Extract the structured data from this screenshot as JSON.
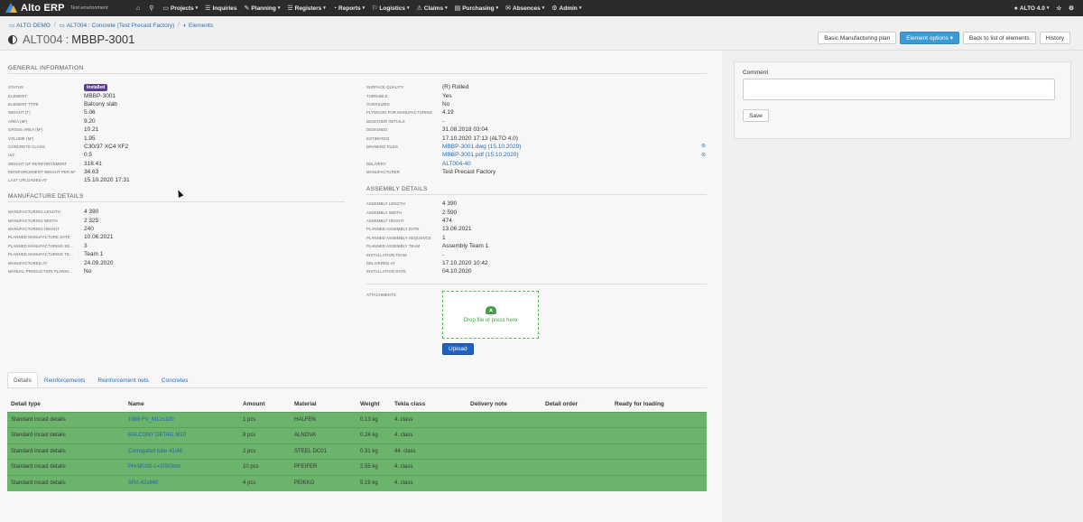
{
  "app": {
    "brand": "Alto ERP",
    "environment": "Test environment",
    "menu": [
      {
        "icon": "⌂",
        "label": "",
        "name": "home",
        "caret": false
      },
      {
        "icon": "⚲",
        "label": "",
        "name": "search",
        "caret": false
      },
      {
        "icon": "▭",
        "label": "Projects",
        "name": "projects",
        "caret": true
      },
      {
        "icon": "☰",
        "label": "Inquiries",
        "name": "inquiries",
        "caret": false
      },
      {
        "icon": "✎",
        "label": "Planning",
        "name": "planning",
        "caret": true
      },
      {
        "icon": "☰",
        "label": "Registers",
        "name": "registers",
        "caret": true
      },
      {
        "icon": "◔",
        "label": "Reports",
        "name": "reports",
        "caret": true
      },
      {
        "icon": "⚐",
        "label": "Logistics",
        "name": "logistics",
        "caret": true
      },
      {
        "icon": "⚠",
        "label": "Claims",
        "name": "claims",
        "caret": true
      },
      {
        "icon": "▤",
        "label": "Purchasing",
        "name": "purchasing",
        "caret": true
      },
      {
        "icon": "✉",
        "label": "Absences",
        "name": "absences",
        "caret": true
      },
      {
        "icon": "⚙",
        "label": "Admin",
        "name": "admin",
        "caret": true
      }
    ],
    "user_label": "ALTO 4.0",
    "star_icon": "☆",
    "settings_icon": "⚙"
  },
  "breadcrumb": [
    {
      "label": "ALTO DEMO",
      "icon": "▭"
    },
    {
      "label": "ALT004 : Concrete (Test Precast Factory)",
      "icon": "▭"
    },
    {
      "label": "Elements",
      "icon": "◐"
    }
  ],
  "title": {
    "prefix": "ALT004",
    "separator": ":",
    "code": "MBBP-3001"
  },
  "actions": {
    "basic_plan": "Basic Manufacturing plan",
    "element_options": "Element options",
    "back": "Back to list of elements",
    "history": "History"
  },
  "general": {
    "title": "GENERAL INFORMATION",
    "left": [
      {
        "label": "Status",
        "value": "Installed",
        "badge": true
      },
      {
        "label": "Element",
        "value": "MBBP-3001"
      },
      {
        "label": "Element type",
        "value": "Balcony slab"
      },
      {
        "label": "Weight (t)",
        "value": "5.06"
      },
      {
        "label": "Area (m²)",
        "value": "9.20"
      },
      {
        "label": "Gross area (m²)",
        "value": "10.21"
      },
      {
        "label": "Volume (m³)",
        "value": "1.95"
      },
      {
        "label": "Concrete class",
        "value": "C30/37 XC4 XF2"
      },
      {
        "label": "U/C",
        "value": "0.5"
      },
      {
        "label": "Weight of reinforcement",
        "value": "318.41"
      },
      {
        "label": "Reinforcement weight per m³",
        "value": "34.63"
      },
      {
        "label": "Last uploaded at",
        "value": "15.10.2020 17:31"
      }
    ],
    "right": [
      {
        "label": "Surface quality",
        "value": "(R) Rolled"
      },
      {
        "label": "Turnable",
        "value": "Yes"
      },
      {
        "label": "Oversized",
        "value": "No"
      },
      {
        "label": "Plywood for manufacturing",
        "value": "4.19"
      },
      {
        "label": "Designer initials",
        "value": "-"
      },
      {
        "label": "Designed",
        "value": "31.08.2018 03:04"
      },
      {
        "label": "Estimated",
        "value": "17.10.2020 17:13 (ALTO 4.0)"
      },
      {
        "label": "Drawing files",
        "value": "MBBP-3001.dwg (15.10.2020)",
        "link": true
      },
      {
        "label": "",
        "value": "MBBP-3001.pdf (15.10.2020)",
        "link": true
      },
      {
        "label": "Delivery",
        "value": "ALT004-40",
        "link": true
      },
      {
        "label": "Manufacturer",
        "value": "Test Precast Factory"
      }
    ]
  },
  "manufacture": {
    "title": "MANUFACTURE DETAILS",
    "rows": [
      {
        "label": "Manufacturing length",
        "value": "4 390"
      },
      {
        "label": "Manufacturing width",
        "value": "2 325"
      },
      {
        "label": "Manufacturing height",
        "value": "240"
      },
      {
        "label": "Planned manufacture date",
        "value": "10.06.2021"
      },
      {
        "label": "Planned manufacturing se...",
        "value": "3"
      },
      {
        "label": "Planned manufacturing te...",
        "value": "Team 1"
      },
      {
        "label": "Manufactured at",
        "value": "24.09.2020"
      },
      {
        "label": "Manual production planni...",
        "value": "No"
      }
    ]
  },
  "assembly": {
    "title": "ASSEMBLY DETAILS",
    "rows": [
      {
        "label": "Assembly length",
        "value": "4 390"
      },
      {
        "label": "Assembly width",
        "value": "2 590"
      },
      {
        "label": "Assembly height",
        "value": "474"
      },
      {
        "label": "Planned assembly date",
        "value": "13.06.2021"
      },
      {
        "label": "Planned assembly sequence",
        "value": "1"
      },
      {
        "label": "Planned assembly team",
        "value": "Assembly Team 1"
      },
      {
        "label": "Installation team",
        "value": "-"
      },
      {
        "label": "Delivered at",
        "value": "17.10.2020 10:42"
      },
      {
        "label": "Installation date",
        "value": "04.10.2020"
      }
    ]
  },
  "attachments": {
    "label": "Attachments",
    "dropzone_text": "Drop file or press here",
    "upload": "Upload"
  },
  "tabs": [
    "Details",
    "Reinforcements",
    "Reinforcement nets",
    "Concretes"
  ],
  "table": {
    "headers": [
      "Detail type",
      "Name",
      "Amount",
      "Material",
      "Weight",
      "Tekla class",
      "Delivery note",
      "Detail order",
      "Ready for loading"
    ],
    "rows": [
      [
        "Standard incast details",
        "1988 FV_M12x100",
        "1 pcs",
        "HALFEN",
        "0.13 kg",
        "4. class",
        "",
        "",
        ""
      ],
      [
        "Standard incast details",
        "BALCONY DETAIL M10",
        "8 pcs",
        "ALNOVA",
        "0.24 kg",
        "4. class",
        "",
        "",
        ""
      ],
      [
        "Standard incast details",
        "Corrugated tube 41/46",
        "2 pcs",
        "STEEL DC01",
        "0.31 kg",
        "44. class",
        "",
        "",
        ""
      ],
      [
        "Standard incast details",
        "PH-MU20-L=1000mm",
        "10 pcs",
        "PFEIFER",
        "2.55 kg",
        "4. class",
        "",
        "",
        ""
      ],
      [
        "Standard incast details",
        "SRA 42x840",
        "4 pcs",
        "PEIKKO",
        "5.19 kg",
        "4. class",
        "",
        "",
        ""
      ]
    ]
  },
  "comment": {
    "label": "Comment",
    "save": "Save"
  },
  "colors": {
    "navbar": "#2b2b2b",
    "row_green": "#6cb46b",
    "primary": "#3a9bd5",
    "upload": "#1f63c0",
    "badge": "#5b3d8e",
    "link": "#2a6db0"
  }
}
